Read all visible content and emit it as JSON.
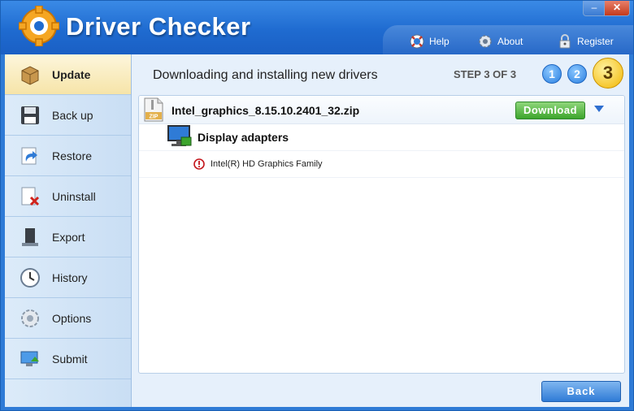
{
  "app": {
    "title": "Driver Checker",
    "window_controls": {
      "minimize": "–",
      "close": "✕"
    }
  },
  "toplinks": [
    {
      "label": "Help",
      "icon": "lifebuoy-icon"
    },
    {
      "label": "About",
      "icon": "gear-icon"
    },
    {
      "label": "Register",
      "icon": "lock-icon"
    }
  ],
  "sidebar": {
    "items": [
      {
        "label": "Update",
        "icon": "box-icon",
        "active": true
      },
      {
        "label": "Back up",
        "icon": "floppy-icon"
      },
      {
        "label": "Restore",
        "icon": "restore-icon"
      },
      {
        "label": "Uninstall",
        "icon": "uninstall-icon"
      },
      {
        "label": "Export",
        "icon": "export-icon"
      },
      {
        "label": "History",
        "icon": "clock-icon"
      },
      {
        "label": "Options",
        "icon": "options-gear-icon"
      },
      {
        "label": "Submit",
        "icon": "submit-icon"
      }
    ]
  },
  "main": {
    "title": "Downloading and installing new drivers",
    "step_text": "STEP 3 OF 3",
    "steps": [
      "1",
      "2",
      "3"
    ],
    "file": {
      "name": "Intel_graphics_8.15.10.2401_32.zip",
      "icon_label": "ZIP",
      "download_label": "Download"
    },
    "category": {
      "label": "Display adapters"
    },
    "device": {
      "label": "Intel(R) HD Graphics Family"
    },
    "back_label": "Back"
  },
  "colors": {
    "accent": "#1f6bd0",
    "download": "#3da52d",
    "step_active": "#f2b600",
    "warning": "#c4161c"
  }
}
